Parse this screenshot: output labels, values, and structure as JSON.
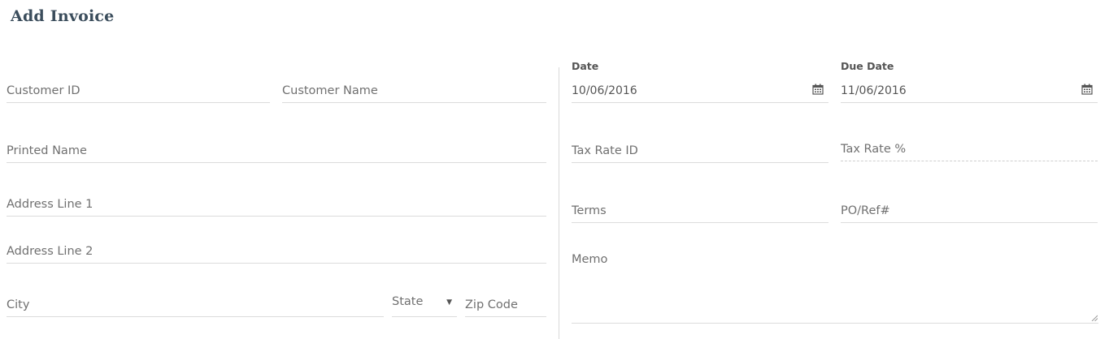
{
  "page": {
    "title": "Add Invoice"
  },
  "left_form": {
    "customer_id": {
      "placeholder": "Customer ID",
      "value": ""
    },
    "customer_name": {
      "placeholder": "Customer Name",
      "value": ""
    },
    "printed_name": {
      "placeholder": "Printed Name",
      "value": ""
    },
    "address_line_1": {
      "placeholder": "Address Line 1",
      "value": ""
    },
    "address_line_2": {
      "placeholder": "Address Line 2",
      "value": ""
    },
    "city": {
      "placeholder": "City",
      "value": ""
    },
    "state": {
      "selected": "State",
      "options": [
        "State"
      ]
    },
    "zip_code": {
      "placeholder": "Zip Code",
      "value": ""
    }
  },
  "right_form": {
    "date": {
      "label": "Date",
      "value": "10/06/2016",
      "icon": "calendar-icon"
    },
    "due_date": {
      "label": "Due Date",
      "value": "11/06/2016",
      "icon": "calendar-icon"
    },
    "tax_rate_id": {
      "placeholder": "Tax Rate ID",
      "value": ""
    },
    "tax_rate_pct": {
      "placeholder": "Tax Rate %",
      "value": ""
    },
    "terms": {
      "placeholder": "Terms",
      "value": ""
    },
    "po_ref": {
      "placeholder": "PO/Ref#",
      "value": ""
    },
    "memo": {
      "placeholder": "Memo",
      "value": ""
    }
  },
  "colors": {
    "title": "#3b4d5c",
    "text": "#666666",
    "underline": "#dcdcdc"
  }
}
